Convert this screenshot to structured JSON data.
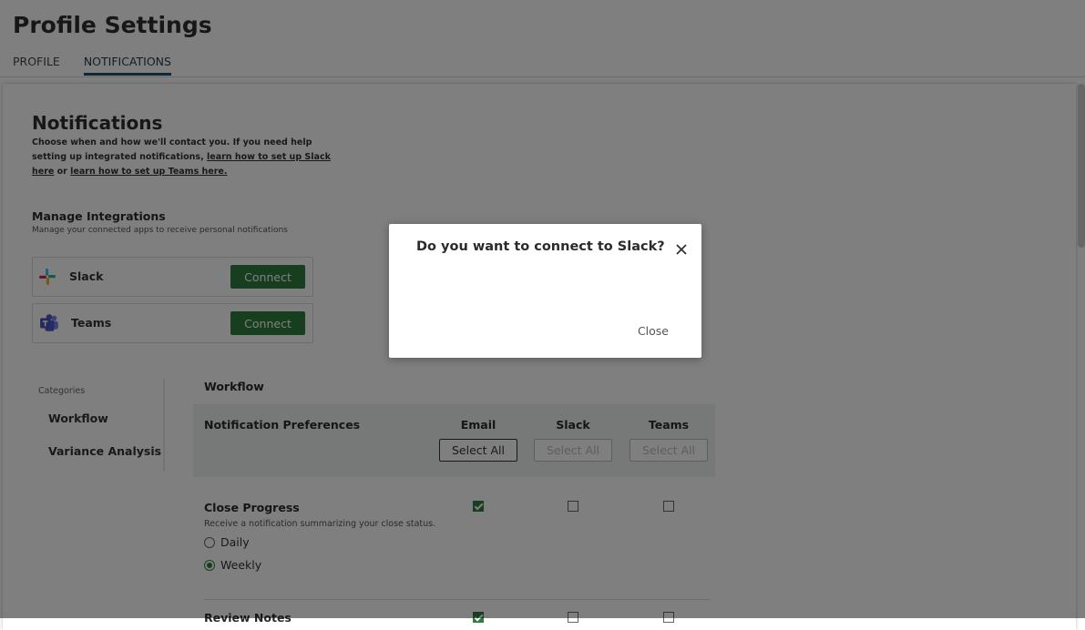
{
  "page": {
    "title": "Profile Settings"
  },
  "tabs": [
    {
      "label": "PROFILE"
    },
    {
      "label": "NOTIFICATIONS"
    }
  ],
  "notifications": {
    "title": "Notifications",
    "desc_prefix": "Choose when and how we'll contact you. If you need help setting up integrated notifications, ",
    "slack_link": "learn how to set up Slack here",
    "or": " or ",
    "teams_link": "learn how to set up Teams here."
  },
  "integrations": {
    "title": "Manage Integrations",
    "desc": "Manage your connected apps to receive personal notifications",
    "items": [
      {
        "name": "Slack",
        "button": "Connect",
        "icon": "slack-icon"
      },
      {
        "name": "Teams",
        "button": "Connect",
        "icon": "teams-icon"
      }
    ]
  },
  "categories": {
    "label": "Categories",
    "items": [
      {
        "label": "Workflow"
      },
      {
        "label": "Variance Analysis"
      }
    ]
  },
  "workflow": {
    "title": "Workflow",
    "pref_label": "Notification Preferences",
    "columns": [
      {
        "label": "Email",
        "select_all": "Select All",
        "enabled": true
      },
      {
        "label": "Slack",
        "select_all": "Select All",
        "enabled": false
      },
      {
        "label": "Teams",
        "select_all": "Select All",
        "enabled": false
      }
    ],
    "rows": [
      {
        "title": "Close Progress",
        "desc": "Receive a notification summarizing your close status.",
        "options": [
          {
            "label": "Daily",
            "selected": false
          },
          {
            "label": "Weekly",
            "selected": true
          }
        ],
        "email": true,
        "slack": false,
        "teams": false
      },
      {
        "title": "Review Notes",
        "email": true,
        "slack": false,
        "teams": false
      }
    ]
  },
  "modal": {
    "title": "Do you want to connect to Slack?",
    "close_label": "Close"
  },
  "colors": {
    "accent_green": "#2f7d3f",
    "tab_underline": "#1d4f73",
    "overlay": "rgba(0,0,0,0.5)"
  }
}
